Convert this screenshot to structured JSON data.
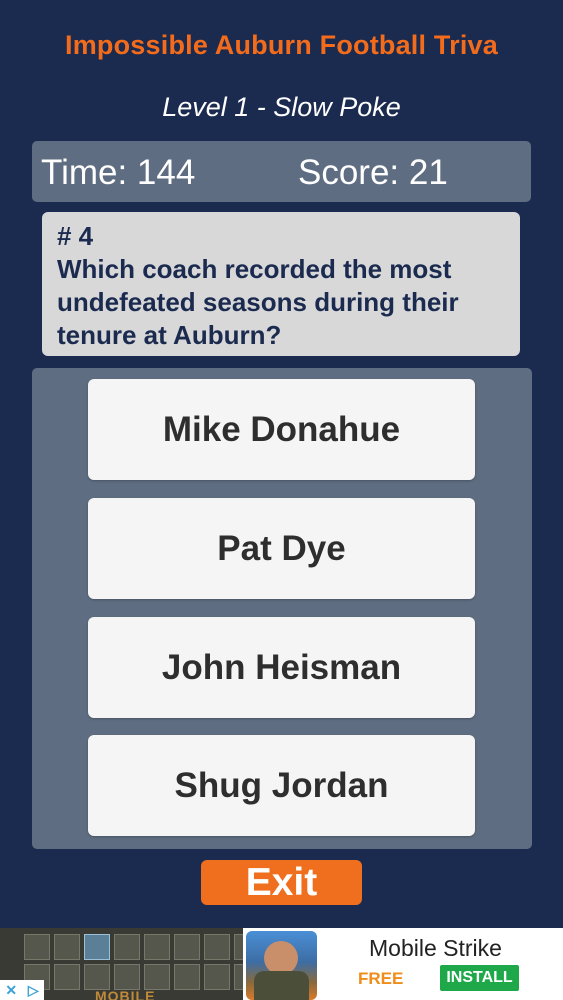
{
  "header": {
    "title": "Impossible Auburn Football Triva",
    "level": "Level 1 - Slow Poke"
  },
  "stats": {
    "time_text": "Time: 144",
    "score_text": "Score: 21"
  },
  "question": {
    "number": "# 4",
    "text": "Which coach recorded the most undefeated seasons during their tenure at Auburn?"
  },
  "answers": [
    {
      "label": "Mike Donahue"
    },
    {
      "label": "Pat Dye"
    },
    {
      "label": "John Heisman"
    },
    {
      "label": "Shug Jordan"
    }
  ],
  "exit_label": "Exit",
  "ad": {
    "app_name": "Mobile Strike",
    "price": "FREE",
    "install_label": "INSTALL",
    "game_text": "MOBILE"
  },
  "colors": {
    "background": "#1b2a4f",
    "accent_orange": "#f26c1c",
    "panel": "#5f6d82",
    "question_box": "#d8d8d8",
    "answer_button": "#f5f5f5",
    "install_green": "#1fa84a"
  }
}
